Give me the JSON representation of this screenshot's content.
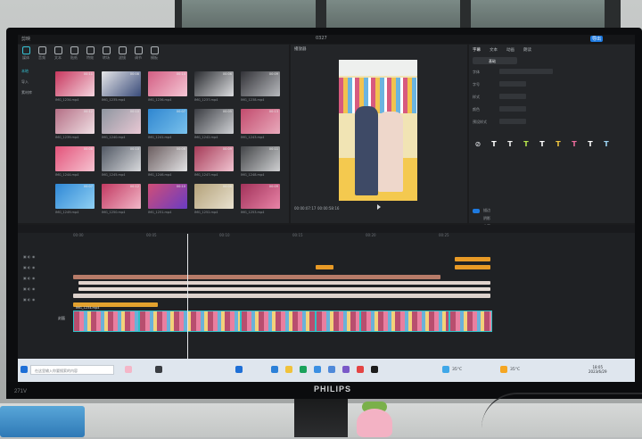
{
  "scene": {
    "monitor_brand": "PHILIPS",
    "monitor_model": "271V"
  },
  "app": {
    "titlebar": {
      "left_text": "剪映",
      "center_text": "0327",
      "right_button": "导出"
    },
    "media_panel": {
      "tools": [
        {
          "label": "媒体",
          "icon": "media-icon",
          "active": true
        },
        {
          "label": "音频",
          "icon": "audio-icon",
          "active": false
        },
        {
          "label": "文本",
          "icon": "text-icon",
          "active": false
        },
        {
          "label": "贴纸",
          "icon": "sticker-icon",
          "active": false
        },
        {
          "label": "特效",
          "icon": "effects-icon",
          "active": false
        },
        {
          "label": "转场",
          "icon": "transition-icon",
          "active": false
        },
        {
          "label": "滤镜",
          "icon": "filter-icon",
          "active": false
        },
        {
          "label": "调节",
          "icon": "adjust-icon",
          "active": false
        },
        {
          "label": "模板",
          "icon": "template-icon",
          "active": false
        }
      ],
      "sidebar": [
        "本地",
        "导入",
        "素材库"
      ],
      "clips": [
        {
          "caption": "IMG_1234.mp4",
          "duration": "00:11",
          "palette": [
            "#c8385f",
            "#f4d4de"
          ]
        },
        {
          "caption": "IMG_1235.mp4",
          "duration": "00:08",
          "palette": [
            "#e6e6e8",
            "#3a4c7a"
          ]
        },
        {
          "caption": "IMG_1236.mp4",
          "duration": "00:14",
          "palette": [
            "#d35e83",
            "#f5c7d5"
          ]
        },
        {
          "caption": "IMG_1237.mp4",
          "duration": "00:06",
          "palette": [
            "#2a2c30",
            "#dcdde0"
          ]
        },
        {
          "caption": "IMG_1238.mp4",
          "duration": "00:09",
          "palette": [
            "#333338",
            "#b7b9bd"
          ]
        },
        {
          "caption": "IMG_1239.mp4",
          "duration": "00:12",
          "palette": [
            "#b46f85",
            "#f0dfe4"
          ]
        },
        {
          "caption": "IMG_1240.mp4",
          "duration": "00:10",
          "palette": [
            "#8e96a0",
            "#e9c8d4"
          ]
        },
        {
          "caption": "IMG_1241.mp4",
          "duration": "00:07",
          "palette": [
            "#2f86d0",
            "#79c1ec"
          ]
        },
        {
          "caption": "IMG_1242.mp4",
          "duration": "00:05",
          "palette": [
            "#3a3c42",
            "#cfd1d4"
          ]
        },
        {
          "caption": "IMG_1243.mp4",
          "duration": "00:13",
          "palette": [
            "#c24b6d",
            "#e9aabc"
          ]
        },
        {
          "caption": "IMG_1244.mp4",
          "duration": "00:08",
          "palette": [
            "#e3537a",
            "#f6c3d1"
          ]
        },
        {
          "caption": "IMG_1245.mp4",
          "duration": "00:10",
          "palette": [
            "#515864",
            "#d8d9dc"
          ]
        },
        {
          "caption": "IMG_1246.mp4",
          "duration": "00:06",
          "palette": [
            "#6b5d5f",
            "#e3e3e5"
          ]
        },
        {
          "caption": "IMG_1247.mp4",
          "duration": "00:09",
          "palette": [
            "#a53a57",
            "#f1c4d1"
          ]
        },
        {
          "caption": "IMG_1248.mp4",
          "duration": "00:11",
          "palette": [
            "#434548",
            "#cfd0d2"
          ]
        },
        {
          "caption": "IMG_1249.mp4",
          "duration": "00:07",
          "palette": [
            "#2f88d6",
            "#8fd0f3"
          ]
        },
        {
          "caption": "IMG_1250.mp4",
          "duration": "00:12",
          "palette": [
            "#c23a62",
            "#f2b7c8"
          ]
        },
        {
          "caption": "IMG_1251.mp4",
          "duration": "00:10",
          "palette": [
            "#d04e77",
            "#6a3cc2"
          ]
        },
        {
          "caption": "IMG_1252.mp4",
          "duration": "00:08",
          "palette": [
            "#b4a27a",
            "#e8e1cf"
          ]
        },
        {
          "caption": "IMG_1253.mp4",
          "duration": "00:09",
          "palette": [
            "#a2325a",
            "#e884a7"
          ]
        }
      ]
    },
    "player": {
      "title": "播放器",
      "current_time": "00:00:07:17",
      "total_time": "00:00:58:16"
    },
    "properties": {
      "tabs": [
        "字幕",
        "文本",
        "动画",
        "朗读"
      ],
      "subtab": "基础",
      "rows": [
        "字体",
        "字号",
        "样式",
        "颜色",
        "预设样式"
      ],
      "section2": [
        "描边",
        "阴影",
        "位置"
      ]
    },
    "timeline": {
      "ruler_ticks": [
        "00:00",
        "00:05",
        "00:10",
        "00:15",
        "00:20",
        "00:25"
      ],
      "cover_label": "封面",
      "main_track_label": "IMG_1234.mp4"
    },
    "taskbar": {
      "search_placeholder": "在这里输入你要搜索的内容",
      "weather_1": "35°C",
      "weather_2": "35°C",
      "time": "18:05",
      "date": "2023/6/29"
    }
  }
}
